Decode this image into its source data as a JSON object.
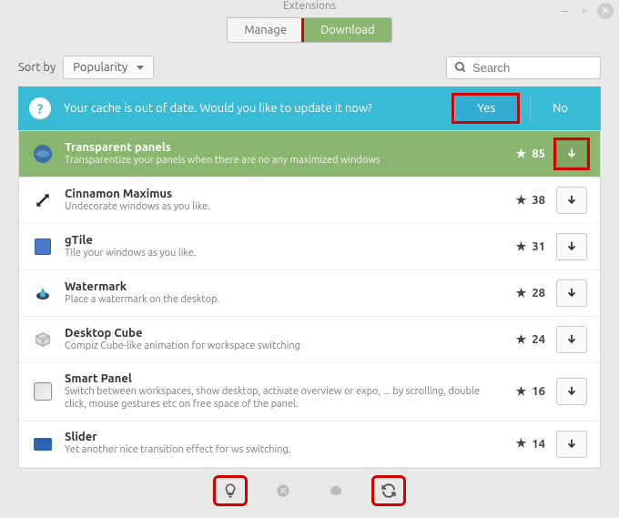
{
  "window": {
    "title": "Extensions"
  },
  "tabs": {
    "manage": "Manage",
    "download": "Download"
  },
  "sort": {
    "label": "Sort by",
    "value": "Popularity"
  },
  "search": {
    "placeholder": "Search"
  },
  "notice": {
    "text": "Your cache is out of date. Would you like to update it now?",
    "yes": "Yes",
    "no": "No"
  },
  "ext": [
    {
      "name": "Transparent panels",
      "desc": "Transparentize your panels when there are no any maximized windows",
      "stars": "85"
    },
    {
      "name": "Cinnamon Maximus",
      "desc": "Undecorate windows as you like.",
      "stars": "38"
    },
    {
      "name": "gTile",
      "desc": "Tile your windows as you like.",
      "stars": "31"
    },
    {
      "name": "Watermark",
      "desc": "Place a watermark on the desktop.",
      "stars": "28"
    },
    {
      "name": "Desktop Cube",
      "desc": "Compiz Cube-like animation for workspace switching",
      "stars": "24"
    },
    {
      "name": "Smart Panel",
      "desc": "Switch between workspaces, show desktop, activate overview or expo, ... by scrolling, double click, mouse gestures etc on free space of the panel.",
      "stars": "16"
    },
    {
      "name": "Slider",
      "desc": "Yet another nice transition effect for ws switching.",
      "stars": "14"
    }
  ]
}
